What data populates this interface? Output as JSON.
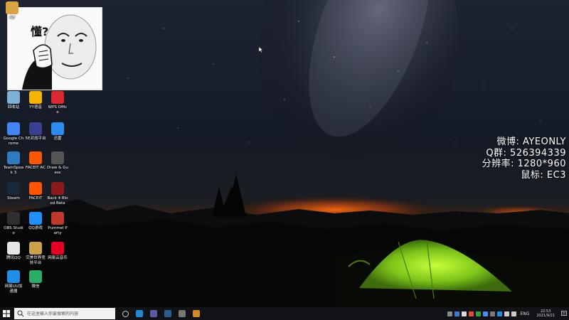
{
  "overlay": {
    "meme_text": "懂?",
    "info_lines": [
      "微博: AYEONLY",
      "Q群: 526394339",
      "分辨率: 1280*960",
      "鼠标: EC3"
    ]
  },
  "desktop_icons": [
    {
      "id": "top-1",
      "label": "Ad",
      "icon": "app-icon",
      "color": "#d9a441"
    },
    {
      "id": "recycle-bin",
      "label": "回收站",
      "icon": "recycle-bin-icon",
      "color": "#7fb0d8"
    },
    {
      "id": "yy-voice",
      "label": "YY语音",
      "icon": "yy-voice-icon",
      "color": "#f5b400"
    },
    {
      "id": "wps-office",
      "label": "WPS Office",
      "icon": "wps-office-icon",
      "color": "#d9282f"
    },
    {
      "id": "google-chrome",
      "label": "Google Chrome",
      "icon": "chrome-icon",
      "color": "#4285f4"
    },
    {
      "id": "5e-platform",
      "label": "5E对战平台",
      "icon": "5e-icon",
      "color": "#3a3f8f"
    },
    {
      "id": "feishu",
      "label": "迅雷",
      "icon": "bird-icon",
      "color": "#2d8cf0"
    },
    {
      "id": "teamspeak",
      "label": "TeamSpeak 3",
      "icon": "teamspeak-icon",
      "color": "#2e7bbf"
    },
    {
      "id": "faceit-ac",
      "label": "FACEIT AC",
      "icon": "faceit-ac-icon",
      "color": "#ff5500"
    },
    {
      "id": "draw-guess",
      "label": "Draw & Guess",
      "icon": "pencil-icon",
      "color": "#555555"
    },
    {
      "id": "steam",
      "label": "Steam",
      "icon": "steam-icon",
      "color": "#1b2838"
    },
    {
      "id": "faceit",
      "label": "FACEIT",
      "icon": "faceit-icon",
      "color": "#ff5500"
    },
    {
      "id": "back4blood",
      "label": "Back 4 Blood Beta",
      "icon": "b4b-icon",
      "color": "#8b1a1a"
    },
    {
      "id": "obs",
      "label": "OBS Studio",
      "icon": "obs-icon",
      "color": "#302e31"
    },
    {
      "id": "qq-games",
      "label": "QQ游戏",
      "icon": "qq-games-icon",
      "color": "#1e90ff"
    },
    {
      "id": "pummel-party",
      "label": "Pummel Party",
      "icon": "pummel-party-icon",
      "color": "#c0392b"
    },
    {
      "id": "tencent-qq",
      "label": "腾讯QQ",
      "icon": "qq-penguin-icon",
      "color": "#e6e6e6"
    },
    {
      "id": "wegame",
      "label": "完美世界竞技平台",
      "icon": "perfect-world-icon",
      "color": "#c9a24a"
    },
    {
      "id": "netease-music",
      "label": "网易云音乐",
      "icon": "netease-music-icon",
      "color": "#e60026"
    },
    {
      "id": "netease-uu",
      "label": "网易UU加速器",
      "icon": "uu-accelerator-icon",
      "color": "#1f8fe5"
    },
    {
      "id": "wechat",
      "label": "微信",
      "icon": "wechat-icon",
      "color": "#2aae67"
    }
  ],
  "taskbar": {
    "search_placeholder": "在这里输入你要搜索的内容",
    "apps": [
      {
        "id": "task-view",
        "icon": "task-view-icon",
        "color": "#cfcfcf"
      },
      {
        "id": "edge",
        "icon": "edge-icon",
        "color": "#1e88d6"
      },
      {
        "id": "app-2",
        "icon": "app-icon",
        "color": "#5a5aa0"
      },
      {
        "id": "steam",
        "icon": "steam-icon",
        "color": "#2b5e8e"
      },
      {
        "id": "obs",
        "icon": "obs-icon",
        "color": "#777777"
      },
      {
        "id": "app-5",
        "icon": "app-icon",
        "color": "#d48a22"
      }
    ],
    "language": "ENG",
    "time": "22:53",
    "date": "2021/9/21"
  }
}
